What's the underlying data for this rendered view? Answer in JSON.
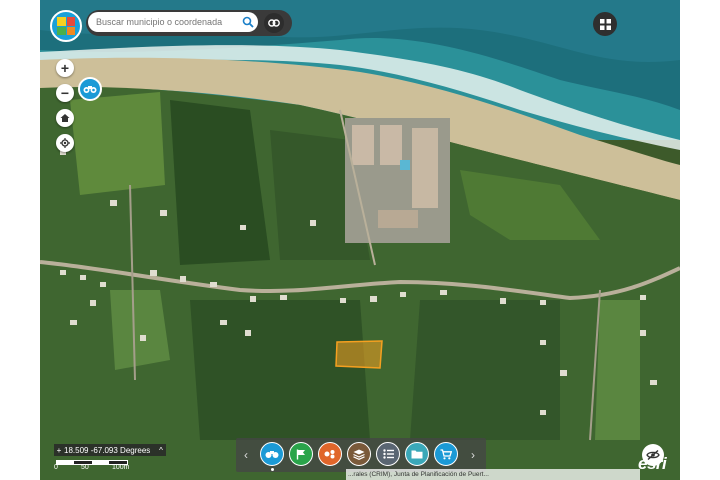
{
  "search": {
    "placeholder": "Buscar municipio o coordenada"
  },
  "icons": {
    "logo": "app-logo-icon",
    "search": "search-icon",
    "link": "link-icon",
    "apps": "apps-grid-icon",
    "zoom_in": "plus-icon",
    "zoom_out": "minus-icon",
    "home": "home-icon",
    "locate": "locate-icon",
    "binoculars": "binoculars-icon",
    "visibility": "eye-off-icon"
  },
  "zoom": {
    "in_label": "+",
    "out_label": "−"
  },
  "coordinates": {
    "plus": "+",
    "text": "18.509 -67.093 Degrees",
    "chevron": "^"
  },
  "scale": {
    "labels": [
      "0",
      "50",
      "100m"
    ]
  },
  "toolbar": {
    "prev": "‹",
    "next": "›",
    "buttons": [
      {
        "name": "binoculars",
        "color": "#1b9ad6"
      },
      {
        "name": "flag",
        "color": "#2aa44a"
      },
      {
        "name": "layers-analysis",
        "color": "#e0662a"
      },
      {
        "name": "layers",
        "color": "#7a5a3a"
      },
      {
        "name": "list",
        "color": "#5a6672"
      },
      {
        "name": "folder",
        "color": "#3aa8b8"
      },
      {
        "name": "cart",
        "color": "#1b9ad6"
      }
    ]
  },
  "attribution": "...rales (CRIM), Junta de Planificación de Puert...",
  "brand": "esri",
  "parcel": {
    "highlight_color": "#f5a020"
  }
}
